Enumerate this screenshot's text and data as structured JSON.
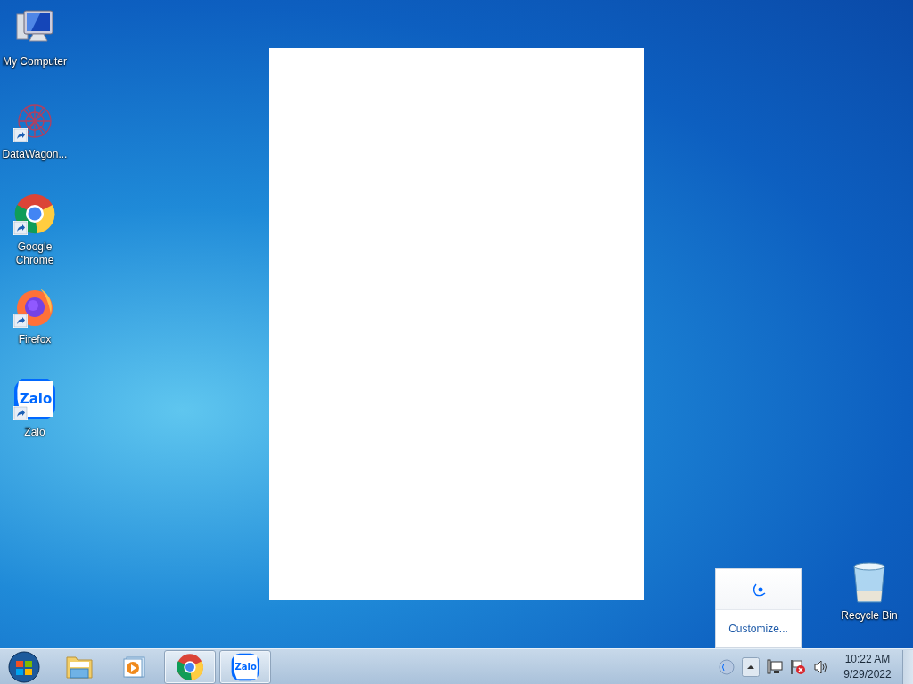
{
  "desktop_icons": [
    {
      "kind": "computer",
      "label": "My Computer",
      "shortcut": false
    },
    {
      "kind": "datawagon",
      "label": "DataWagon...",
      "shortcut": true
    },
    {
      "kind": "chrome",
      "label": "Google Chrome",
      "shortcut": true
    },
    {
      "kind": "firefox",
      "label": "Firefox",
      "shortcut": true
    },
    {
      "kind": "zalo",
      "label": "Zalo",
      "shortcut": true,
      "logo_text": "Zalo"
    }
  ],
  "recycle_bin": {
    "label": "Recycle Bin"
  },
  "tray_popup": {
    "action": "Customize..."
  },
  "taskbar": {
    "items": [
      {
        "kind": "explorer",
        "running": false
      },
      {
        "kind": "media",
        "running": false
      },
      {
        "kind": "chrome",
        "running": true
      },
      {
        "kind": "zalo",
        "running": true,
        "logo_text": "Zalo"
      }
    ],
    "clock": {
      "time": "10:22 AM",
      "date": "9/29/2022"
    }
  }
}
